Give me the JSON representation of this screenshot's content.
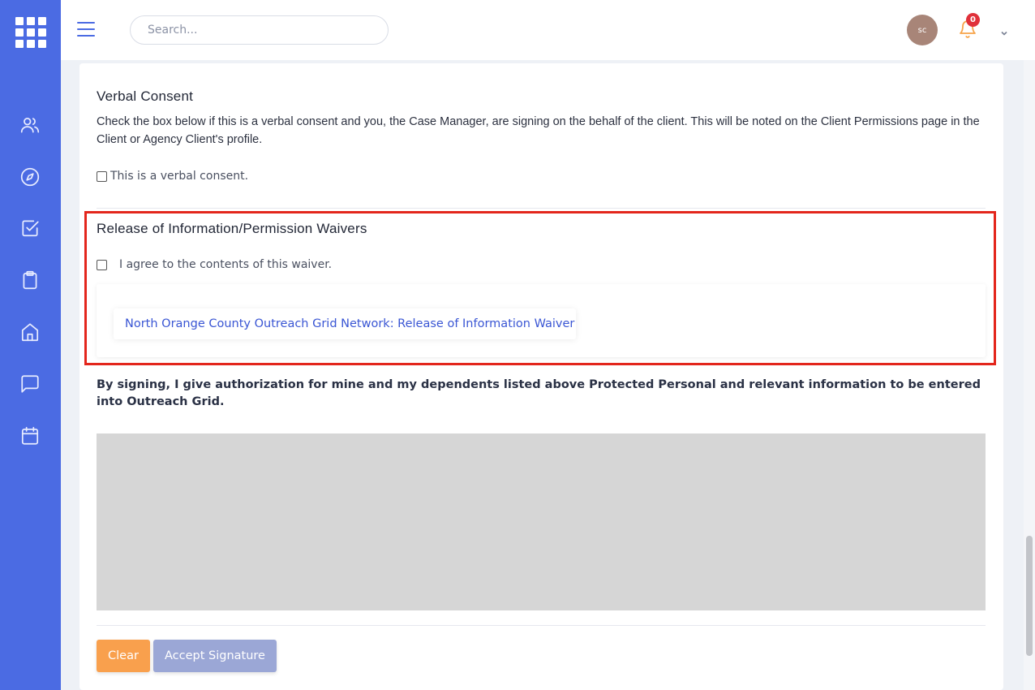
{
  "header": {
    "search_placeholder": "Search...",
    "avatar_initials": "sc",
    "notification_count": "0"
  },
  "sidebar": {
    "items": [
      {
        "icon": "users-icon"
      },
      {
        "icon": "compass-icon"
      },
      {
        "icon": "checkbox-icon"
      },
      {
        "icon": "clipboard-icon"
      },
      {
        "icon": "home-icon"
      },
      {
        "icon": "chat-icon"
      },
      {
        "icon": "calendar-icon"
      }
    ]
  },
  "verbal_consent": {
    "title": "Verbal Consent",
    "description": "Check the box below if this is a verbal consent and you, the Case Manager, are signing on the behalf of the client. This will be noted on the Client Permissions page in the Client or Agency Client's profile.",
    "checkbox_label": "This is a verbal consent.",
    "checked": false
  },
  "release": {
    "title": "Release of Information/Permission Waivers",
    "checkbox_label": "I agree to the contents of this waiver.",
    "checked": false,
    "waiver_link": "North Orange County Outreach Grid Network: Release of Information Waiver"
  },
  "authorization_text": "By signing, I give authorization for mine and my dependents listed above Protected Personal and relevant information to be entered into Outreach Grid.",
  "buttons": {
    "clear": "Clear",
    "accept": "Accept Signature"
  },
  "colors": {
    "sidebar": "#4b6be3",
    "highlight": "#e3261c",
    "clear_button": "#f9a04d",
    "accept_button": "#9ba7d6",
    "link": "#3a56d4"
  }
}
